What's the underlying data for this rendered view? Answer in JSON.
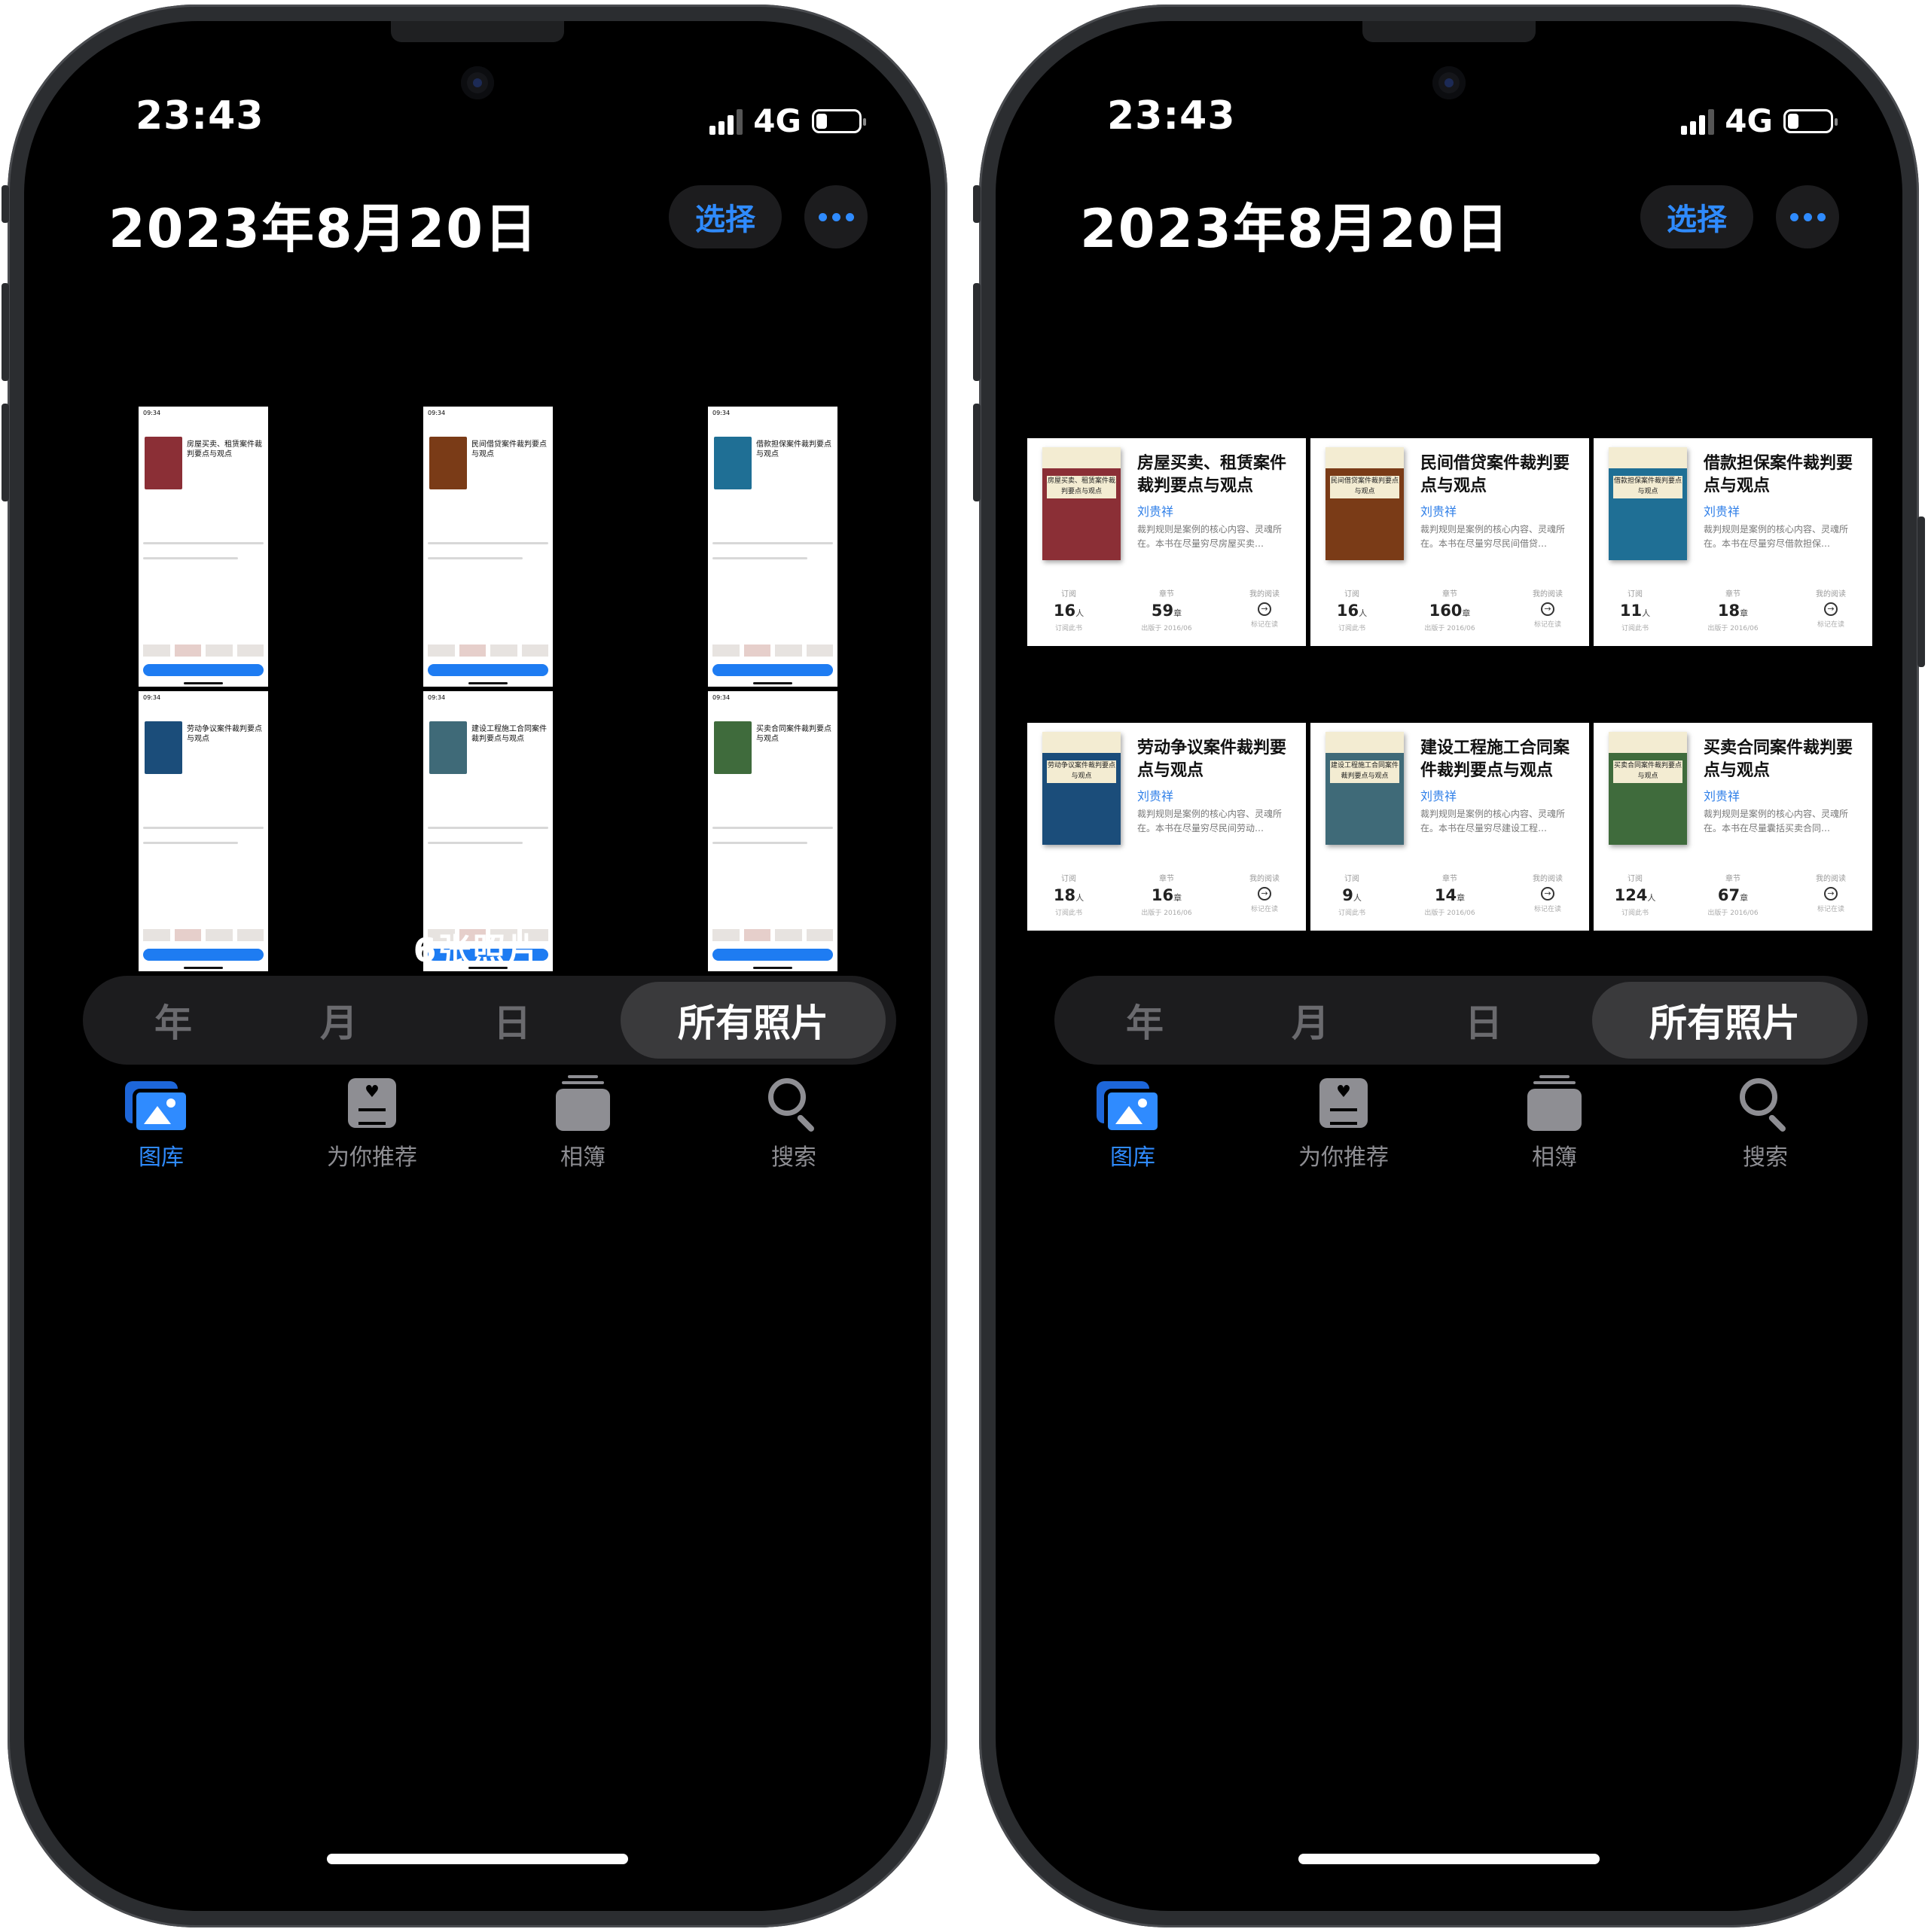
{
  "status": {
    "time": "23:43",
    "network": "4G"
  },
  "header": {
    "date_title": "2023年8月20日",
    "select_label": "选择"
  },
  "photo_count_label": "6张照片",
  "segments": [
    "年",
    "月",
    "日",
    "所有照片"
  ],
  "active_segment": "所有照片",
  "tabs": [
    {
      "label": "图库",
      "icon": "photo-library-icon"
    },
    {
      "label": "为你推荐",
      "icon": "for-you-icon"
    },
    {
      "label": "相簿",
      "icon": "albums-icon"
    },
    {
      "label": "搜索",
      "icon": "search-icon"
    }
  ],
  "active_tab": "图库",
  "books": [
    {
      "title": "房屋买卖、租赁案件裁判要点与观点",
      "author": "刘贵祥",
      "desc": "裁判规则是案例的核心内容、灵魂所在。本书在尽量穷尽房屋买卖…",
      "subscribers": "16",
      "chapters": "59",
      "cover_color": "#8b2f36"
    },
    {
      "title": "民间借贷案件裁判要点与观点",
      "author": "刘贵祥",
      "desc": "裁判规则是案例的核心内容、灵魂所在。本书在尽量穷尽民间借贷…",
      "subscribers": "16",
      "chapters": "160",
      "cover_color": "#7a3b17"
    },
    {
      "title": "借款担保案件裁判要点与观点",
      "author": "刘贵祥",
      "desc": "裁判规则是案例的核心内容、灵魂所在。本书在尽量穷尽借款担保…",
      "subscribers": "11",
      "chapters": "18",
      "cover_color": "#1f6f95"
    },
    {
      "title": "劳动争议案件裁判要点与观点",
      "author": "刘贵祥",
      "desc": "裁判规则是案例的核心内容、灵魂所在。本书在尽量穷尽民间劳动…",
      "subscribers": "18",
      "chapters": "16",
      "cover_color": "#1b4d7a"
    },
    {
      "title": "建设工程施工合同案件裁判要点与观点",
      "author": "刘贵祥",
      "desc": "裁判规则是案例的核心内容、灵魂所在。本书在尽量穷尽建设工程…",
      "subscribers": "9",
      "chapters": "14",
      "cover_color": "#3f6a78"
    },
    {
      "title": "买卖合同案件裁判要点与观点",
      "author": "刘贵祥",
      "desc": "裁判规则是案例的核心内容、灵魂所在。本书在尽量囊括买卖合同…",
      "subscribers": "124",
      "chapters": "67",
      "cover_color": "#3f6b3c"
    }
  ],
  "card_stats_labels": {
    "subscribe": "订阅",
    "chapters": "章节",
    "my_reading": "我的阅读",
    "people_unit": "人",
    "chapter_unit": "章",
    "subscribe_sub": "订阅此书",
    "published_sub": "出版于 2016/06",
    "mark_sub": "标记在读"
  },
  "thumb_time": "09:34",
  "colors": {
    "accent": "#2f8bff",
    "background": "#000000",
    "segment_bg": "#1c1c1e",
    "segment_active": "#3a3a3c"
  }
}
